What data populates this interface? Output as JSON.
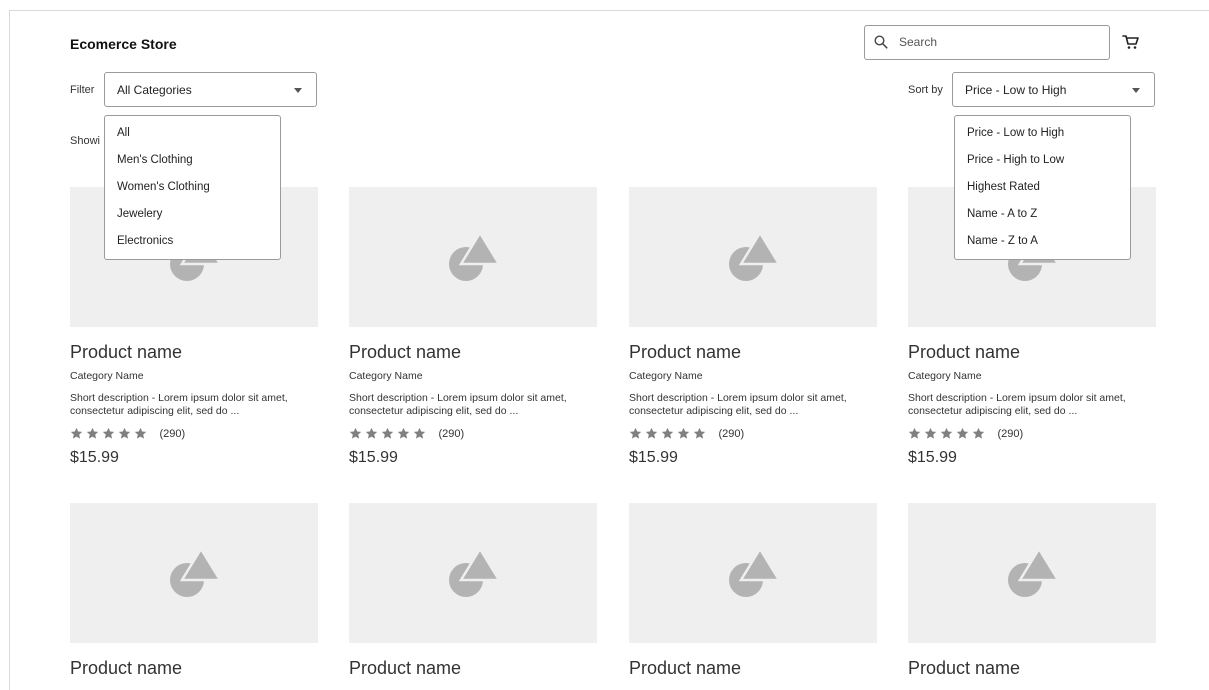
{
  "header": {
    "store_title": "Ecomerce Store",
    "search_placeholder": "Search"
  },
  "filter": {
    "label": "Filter",
    "selected": "All Categories",
    "options": [
      "All",
      "Men's Clothing",
      "Women's Clothing",
      "Jewelery",
      "Electronics"
    ]
  },
  "sort": {
    "label": "Sort by",
    "selected": "Price - Low to High",
    "options": [
      "Price - Low to High",
      "Price - High to Low",
      "Highest Rated",
      "Name - A to Z",
      "Name - Z to A"
    ]
  },
  "results": {
    "showing_text": "Showi"
  },
  "products": [
    {
      "name": "Product name",
      "category": "Category Name",
      "description": "Short description - Lorem ipsum dolor sit amet, consectetur adipiscing elit, sed do ...",
      "rating": 5,
      "review_count": "(290)",
      "price": "$15.99"
    },
    {
      "name": "Product name",
      "category": "Category Name",
      "description": "Short description - Lorem ipsum dolor sit amet, consectetur adipiscing elit, sed do ...",
      "rating": 5,
      "review_count": "(290)",
      "price": "$15.99"
    },
    {
      "name": "Product name",
      "category": "Category Name",
      "description": "Short description - Lorem ipsum dolor sit amet, consectetur adipiscing elit, sed do ...",
      "rating": 5,
      "review_count": "(290)",
      "price": "$15.99"
    },
    {
      "name": "Product name",
      "category": "Category Name",
      "description": "Short description - Lorem ipsum dolor sit amet, consectetur adipiscing elit, sed do ...",
      "rating": 5,
      "review_count": "(290)",
      "price": "$15.99"
    },
    {
      "name": "Product name"
    },
    {
      "name": "Product name"
    },
    {
      "name": "Product name"
    },
    {
      "name": "Product name"
    }
  ],
  "colors": {
    "placeholder_bg": "#efefef",
    "icon": "#b3b3b3",
    "star": "#808080",
    "border": "#9a9a9a"
  },
  "icons": {
    "search": "search-icon",
    "cart": "cart-icon",
    "caret": "caret-down-icon",
    "image_placeholder": "image-placeholder-icon",
    "star": "star-icon"
  }
}
